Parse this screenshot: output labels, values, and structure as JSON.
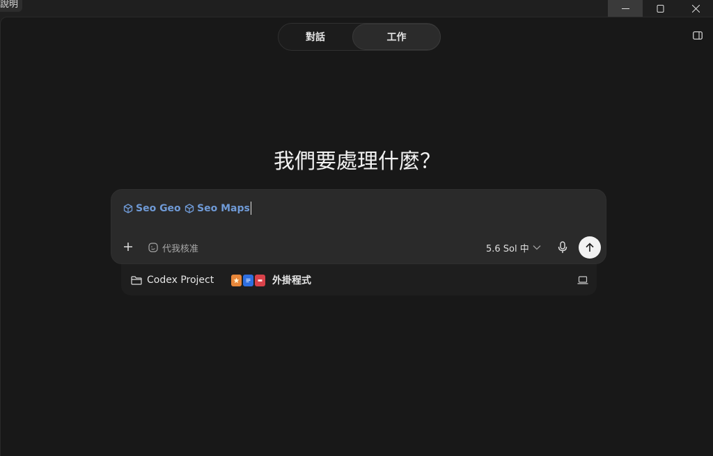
{
  "titlebar": {
    "menu_help": "說明"
  },
  "mode_toggle": {
    "options": [
      "對話",
      "工作"
    ],
    "selected": "工作"
  },
  "main": {
    "heading": "我們要處理什麼？"
  },
  "composer": {
    "chips": [
      {
        "label": "Seo Geo",
        "icon": "cube-icon"
      },
      {
        "label": "Seo Maps",
        "icon": "cube-icon"
      }
    ],
    "approve_label": "代我核准",
    "model_label": "5.6 Sol 中",
    "colors": {
      "chip": "#6f9ad6",
      "background": "#2a2a2a"
    }
  },
  "context_bar": {
    "project_label": "Codex Project",
    "plugins_label": "外掛程式",
    "plugin_icons": [
      "orange-bookmark-icon",
      "blue-doc-icon",
      "red-pdf-icon"
    ]
  }
}
